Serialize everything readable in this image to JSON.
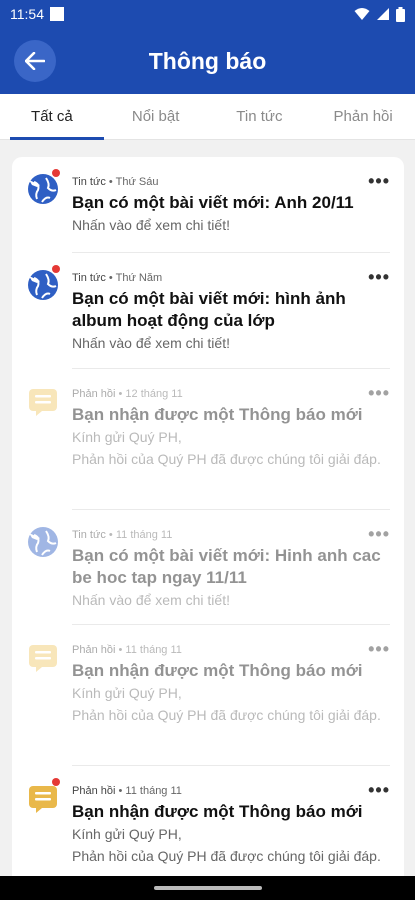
{
  "status_bar": {
    "time": "11:54"
  },
  "app_bar": {
    "title": "Thông báo"
  },
  "tabs": [
    {
      "label": "Tất cả",
      "active": true
    },
    {
      "label": "Nổi bật",
      "active": false
    },
    {
      "label": "Tin tức",
      "active": false
    },
    {
      "label": "Phản hồi",
      "active": false
    }
  ],
  "notifications": [
    {
      "category": "Tin tức",
      "date": "Thứ Sáu",
      "title": "Bạn có một bài viết mới: Anh 20/11",
      "body": [
        "Nhấn vào để xem chi tiết!"
      ],
      "icon": "globe-icon",
      "unread": true
    },
    {
      "category": "Tin tức",
      "date": "Thứ Năm",
      "title": "Bạn có một bài viết mới: hình ảnh album hoạt động của lớp",
      "body": [
        "Nhấn vào để xem chi tiết!"
      ],
      "icon": "globe-icon",
      "unread": true
    },
    {
      "category": "Phản hồi",
      "date": "12 tháng 11",
      "title": "Bạn nhận được một Thông báo mới",
      "body": [
        "Kính gửi Quý PH,",
        "Phản hồi của Quý PH đã được chúng tôi giải đáp."
      ],
      "icon": "message-icon",
      "unread": false
    },
    {
      "category": "Tin tức",
      "date": "11 tháng 11",
      "title": "Bạn có một bài viết mới: Hinh anh cac be hoc tap ngay 11/11",
      "body": [
        "Nhấn vào để xem chi tiết!"
      ],
      "icon": "globe-icon",
      "unread": false
    },
    {
      "category": "Phản hồi",
      "date": "11 tháng 11",
      "title": "Bạn nhận được một Thông báo mới",
      "body": [
        "Kính gửi Quý PH,",
        "Phản hồi của Quý PH đã được chúng tôi giải đáp."
      ],
      "icon": "message-icon",
      "unread": false
    },
    {
      "category": "Phản hồi",
      "date": "11 tháng 11",
      "title": "Bạn nhận được một Thông báo mới",
      "body": [
        "Kính gửi Quý PH,",
        "Phản hồi của Quý PH đã được chúng tôi giải đáp."
      ],
      "icon": "message-icon",
      "unread": true
    }
  ],
  "more_label": "•••",
  "separator": "•",
  "colors": {
    "primary": "#1d4bb0",
    "unread_dot": "#e53935",
    "message_icon": "#f0c868",
    "globe_icon": "#2f5fc4"
  }
}
